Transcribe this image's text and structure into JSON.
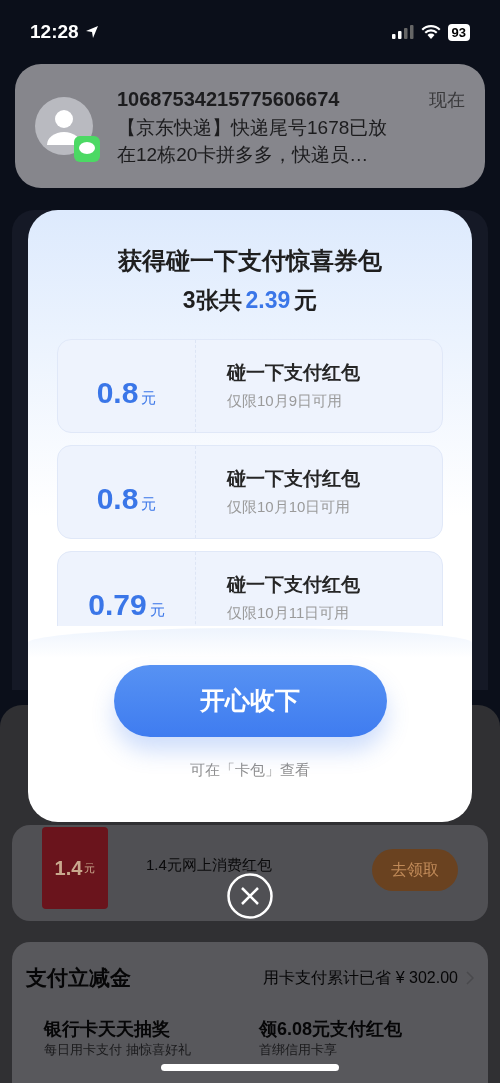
{
  "status_bar": {
    "time": "12:28",
    "battery": "93"
  },
  "notification": {
    "sender": "10687534215775606674",
    "time": "现在",
    "message_lines": [
      "【京东快递】快递尾号1678已放",
      "在12栋20卡拼多多，快递员…"
    ]
  },
  "background": {
    "promo": {
      "packet_amount": "1.4",
      "packet_unit": "元",
      "title": "1.4元网上消费红包",
      "button": "去领取"
    },
    "section": {
      "title": "支付立减金",
      "summary": "用卡支付累计已省 ¥ 302.00",
      "items": [
        {
          "title": "银行卡天天抽奖",
          "subtitle": "每日用卡支付 抽惊喜好礼"
        },
        {
          "title": "领6.08元支付红包",
          "subtitle": "首绑信用卡享"
        }
      ]
    }
  },
  "dialog": {
    "title": "获得碰一下支付惊喜券包",
    "subtitle": {
      "prefix": "3张共",
      "amount": "2.39",
      "suffix": "元"
    },
    "coupons": [
      {
        "amount": "0.8",
        "unit": "元",
        "name": "碰一下支付红包",
        "validity": "仅限10月9日可用"
      },
      {
        "amount": "0.8",
        "unit": "元",
        "name": "碰一下支付红包",
        "validity": "仅限10月10日可用"
      },
      {
        "amount": "0.79",
        "unit": "元",
        "name": "碰一下支付红包",
        "validity": "仅限10月11日可用"
      }
    ],
    "confirm_button": "开心收下",
    "footer_note": "可在「卡包」查看"
  }
}
